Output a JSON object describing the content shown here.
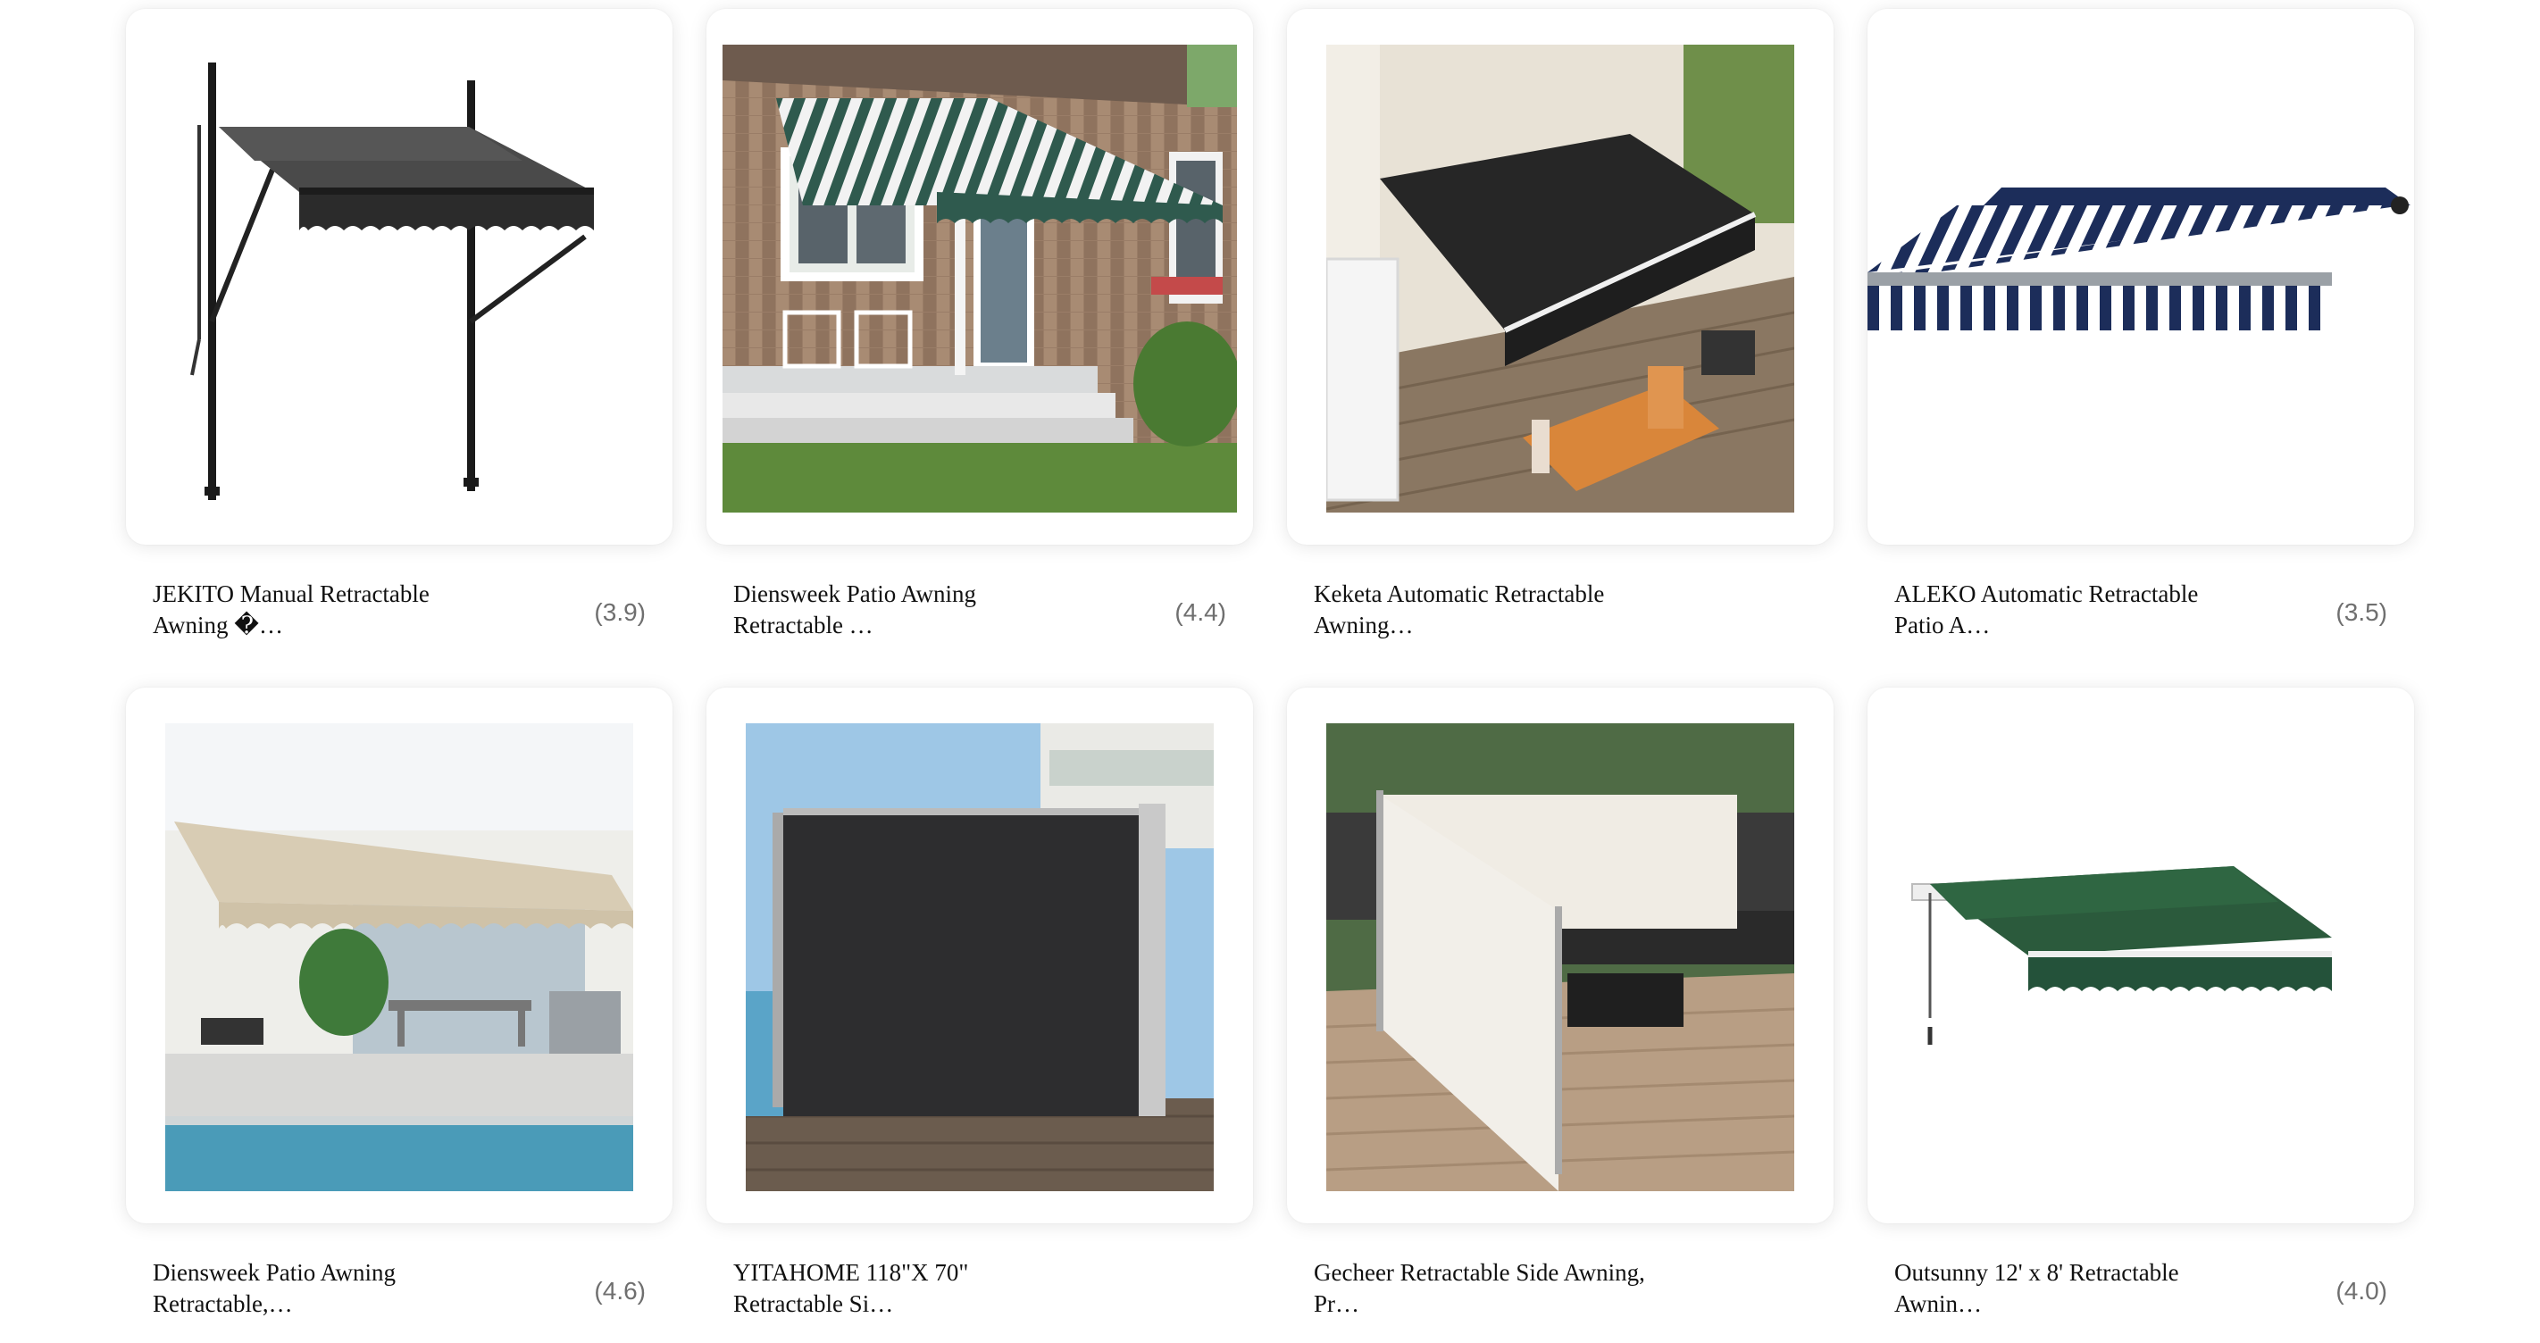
{
  "products": [
    {
      "title_line1": "JEKITO Manual Retractable",
      "title_line2": "Awning �…",
      "rating": "(3.9)",
      "image": "black-manual-pole-awning"
    },
    {
      "title_line1": "Diensweek Patio Awning",
      "title_line2": "Retractable …",
      "rating": "(4.4)",
      "image": "green-white-striped-awning-on-house"
    },
    {
      "title_line1": "Keketa Automatic Retractable",
      "title_line2": "Awning…",
      "rating": "",
      "image": "black-awning-over-patio-table"
    },
    {
      "title_line1": "ALEKO Automatic Retractable",
      "title_line2": "Patio A…",
      "rating": "(3.5)",
      "image": "blue-white-striped-awning"
    },
    {
      "title_line1": "Diensweek Patio Awning",
      "title_line2": "Retractable,…",
      "rating": "(4.6)",
      "image": "beige-awning-by-pool"
    },
    {
      "title_line1": "YITAHOME 118\"X 70\"",
      "title_line2": "Retractable Si…",
      "rating": "",
      "image": "black-side-awning-screen"
    },
    {
      "title_line1": "Gecheer Retractable Side Awning,",
      "title_line2": "Pr…",
      "rating": "",
      "image": "cream-side-awning-on-deck"
    },
    {
      "title_line1": "Outsunny 12' x 8' Retractable",
      "title_line2": "Awnin…",
      "rating": "(4.0)",
      "image": "green-awning"
    }
  ]
}
